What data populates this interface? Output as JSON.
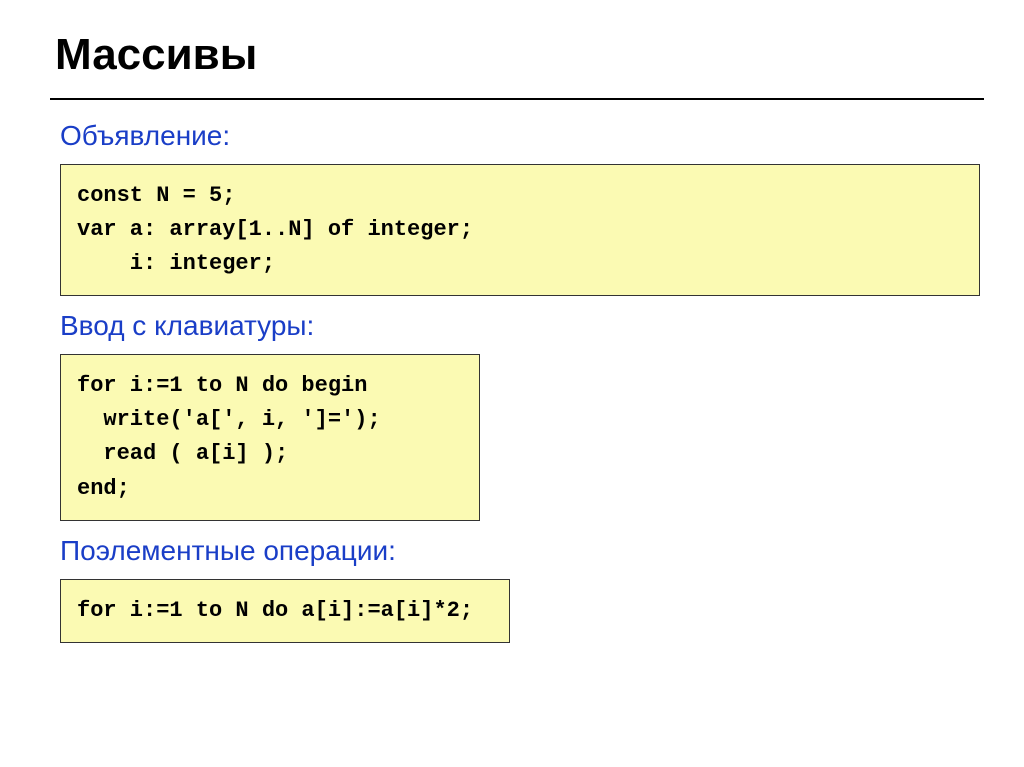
{
  "title": "Массивы",
  "sections": {
    "declaration": {
      "heading": "Объявление:",
      "code": {
        "line1": "const N = 5;",
        "line2": "var a: array[1..N] of integer;",
        "line3": "    i: integer;"
      }
    },
    "input": {
      "heading": "Ввод с клавиатуры:",
      "code": {
        "line1": "for i:=1 to N do begin",
        "line2": "  write('a[', i, ']=');",
        "line3": "  read ( a[i] );",
        "line4": "end;"
      }
    },
    "operations": {
      "heading": "Поэлементные операции:",
      "code": {
        "line1": "for i:=1 to N do a[i]:=a[i]*2;"
      }
    }
  }
}
